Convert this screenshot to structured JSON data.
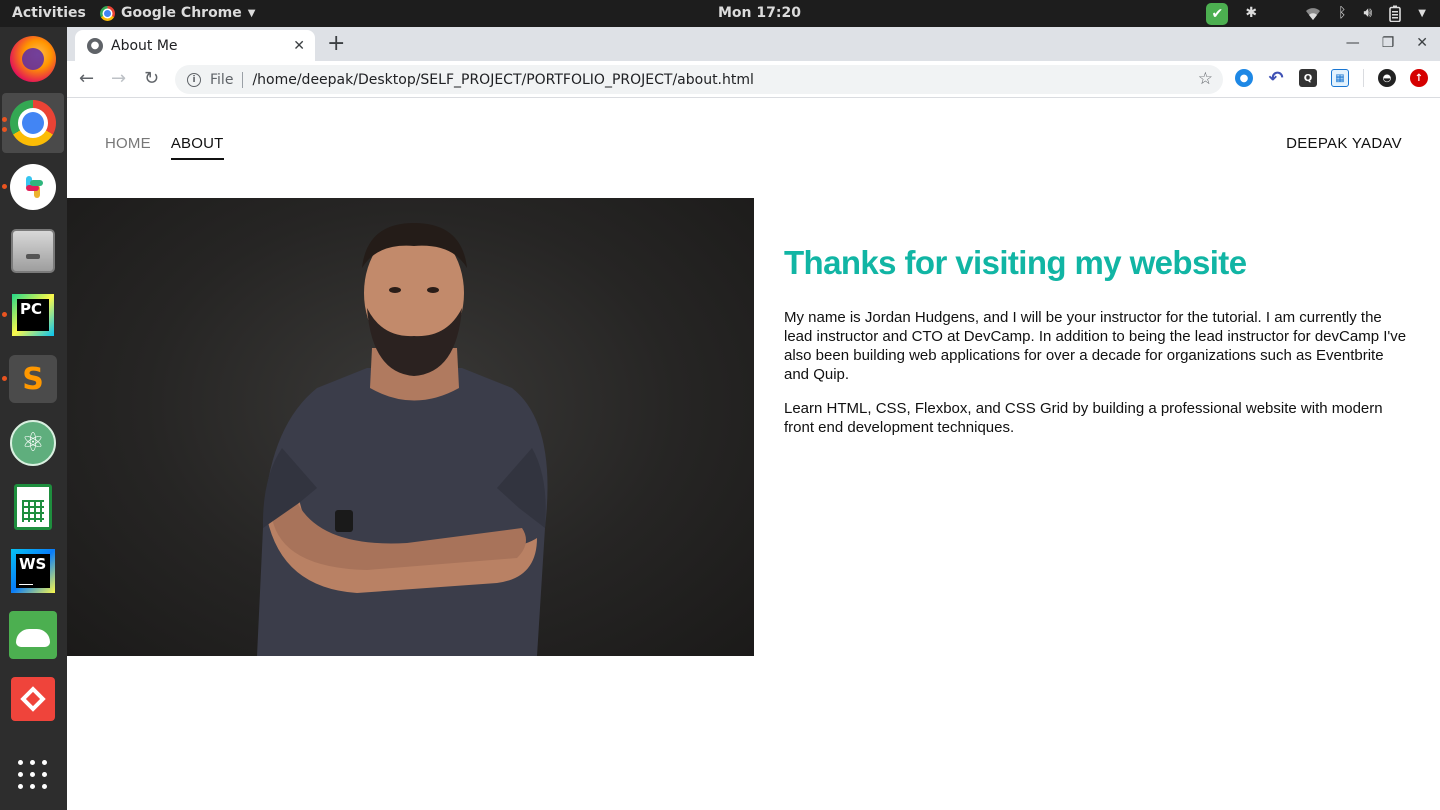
{
  "topbar": {
    "activities": "Activities",
    "app_name": "Google Chrome",
    "clock": "Mon 17:20"
  },
  "dock": {
    "items": [
      {
        "name": "firefox",
        "running": false
      },
      {
        "name": "chrome",
        "running": true
      },
      {
        "name": "slack",
        "running": true
      },
      {
        "name": "files",
        "running": false
      },
      {
        "name": "pycharm",
        "running": true
      },
      {
        "name": "sublime-text",
        "running": true
      },
      {
        "name": "atom",
        "running": false
      },
      {
        "name": "libreoffice-calc",
        "running": false
      },
      {
        "name": "webstorm",
        "running": false
      },
      {
        "name": "mysql-workbench",
        "running": false
      },
      {
        "name": "anydesk",
        "running": false
      },
      {
        "name": "show-applications",
        "running": false
      }
    ],
    "pycharm_label": "PC",
    "webstorm_label": "WS"
  },
  "browser": {
    "tab_title": "About Me",
    "omnibox": {
      "scheme_label": "File",
      "url": "/home/deepak/Desktop/SELF_PROJECT/PORTFOLIO_PROJECT/about.html"
    }
  },
  "site": {
    "nav": {
      "home": "HOME",
      "about": "ABOUT"
    },
    "brand": "DEEPAK YADAV",
    "heading": "Thanks for visiting my website",
    "paragraph1": "My name is Jordan Hudgens, and I will be your instructor for the tutorial. I am currently the lead instructor and CTO at DevCamp. In addition to being the lead instructor for devCamp I've also been building web applications for over a decade for organizations such as Eventbrite and Quip.",
    "paragraph2": "Learn HTML, CSS, Flexbox, and CSS Grid by building a professional website with modern front end development techniques.",
    "accent_color": "#11b5a4"
  }
}
